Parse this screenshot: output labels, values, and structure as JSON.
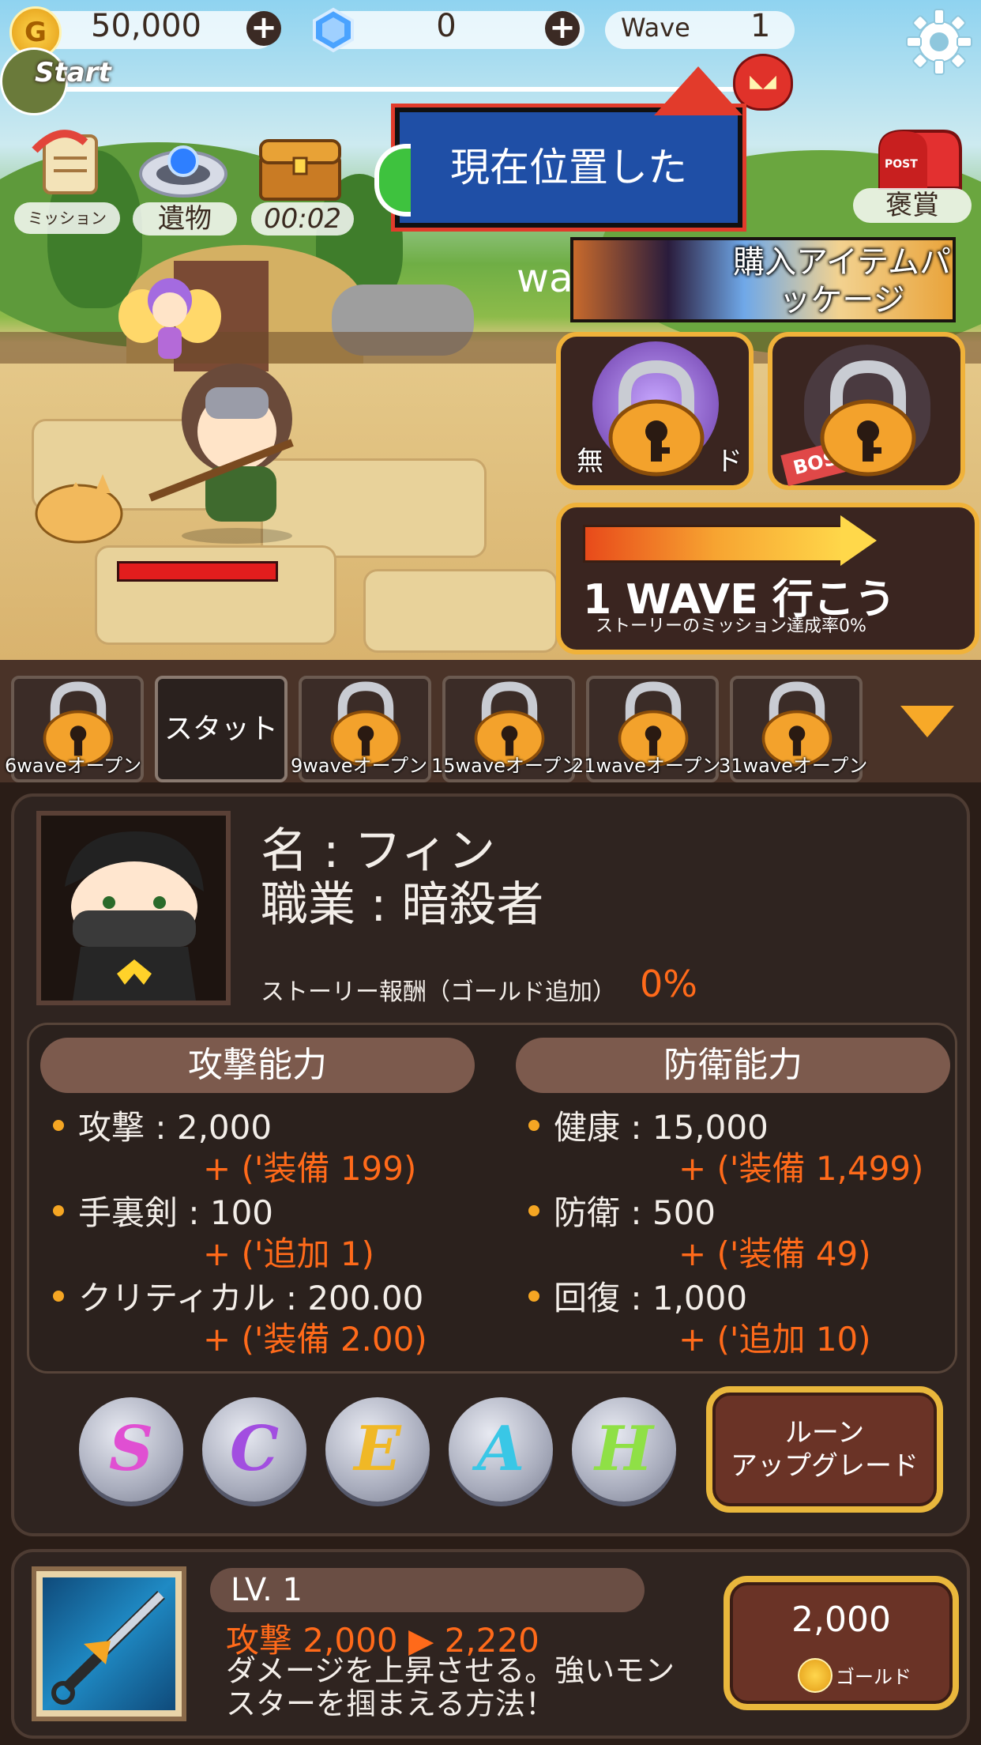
{
  "hud": {
    "gold": "50,000",
    "gems": "0",
    "wave_label": "Wave",
    "wave_value": "1",
    "start_label": "Start"
  },
  "menu": {
    "mission": "ミッション",
    "relic": "遺物",
    "chest_timer": "00:02",
    "reward": "褒賞",
    "post": "POST"
  },
  "tooltip": "現在位置したwave",
  "package_label": "購入アイテムパッケージ",
  "locked_left_label": "無",
  "locked_left_label_tail": "ド",
  "boss_tag": "BOS",
  "go_button": {
    "title": "1 WAVE 行こう",
    "subtitle": "ストーリーのミッション達成率0%"
  },
  "tabs": [
    {
      "label": "",
      "caption": "6waveオープン",
      "locked": true
    },
    {
      "label": "スタット",
      "caption": "",
      "locked": false
    },
    {
      "label": "",
      "caption": "9waveオープン",
      "locked": true
    },
    {
      "label": "",
      "caption": "15waveオープン",
      "locked": true
    },
    {
      "label": "",
      "caption": "21waveオープン",
      "locked": true
    },
    {
      "label": "",
      "caption": "31waveオープン",
      "locked": true
    }
  ],
  "character": {
    "name": "名 : フィン",
    "job": "職業 : 暗殺者",
    "bonus_label": "ストーリー報酬（ゴールド追加）",
    "bonus_value": "0%"
  },
  "attack": {
    "header": "攻撃能力",
    "lines": [
      {
        "main": "攻撃 : 2,000",
        "sub": "+ ('装備 199)"
      },
      {
        "main": "手裏剣 : 100",
        "sub": "+ ('追加 1)"
      },
      {
        "main": "クリティカル : 200.00",
        "sub": "+ ('装備 2.00)"
      }
    ]
  },
  "defense": {
    "header": "防衛能力",
    "lines": [
      {
        "main": "健康 : 15,000",
        "sub": "+ ('装備 1,499)"
      },
      {
        "main": "防衛 : 500",
        "sub": "+ ('装備 49)"
      },
      {
        "main": "回復 : 1,000",
        "sub": "+ ('追加 10)"
      }
    ]
  },
  "runes": [
    {
      "letter": "S",
      "color": "#e04fd2"
    },
    {
      "letter": "C",
      "color": "#a24ee0"
    },
    {
      "letter": "E",
      "color": "#f0b826"
    },
    {
      "letter": "A",
      "color": "#39c7e6"
    },
    {
      "letter": "H",
      "color": "#8fe046"
    }
  ],
  "rune_upgrade": "ルーン\nアップグレード",
  "upgrade": {
    "level": "LV. 1",
    "effect": "攻撃 2,000 ▶ 2,220",
    "desc_line1": "ダメージを上昇させる。強いモン",
    "desc_line2": "スターを掴まえる方法！",
    "price": "2,000",
    "price_unit": "ゴールド"
  },
  "colors": {
    "accent_orange": "#ff6a1a",
    "gold_border": "#e9b73c",
    "tooltip_blue": "#1f4fa6"
  }
}
